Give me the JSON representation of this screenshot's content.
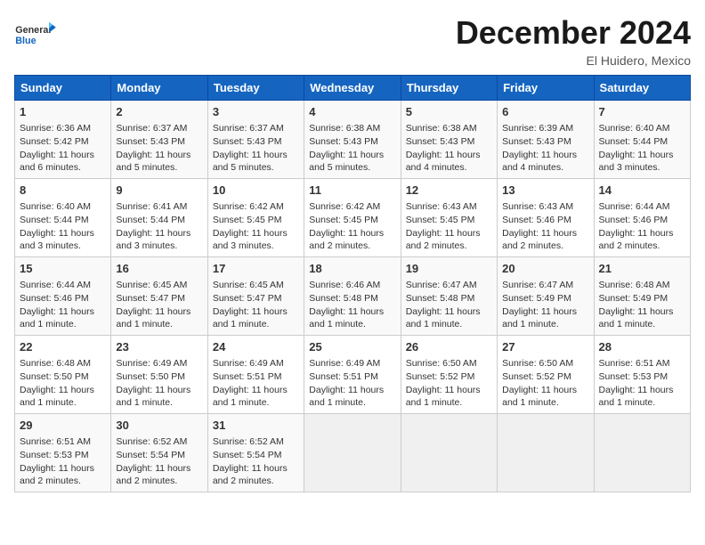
{
  "header": {
    "logo_general": "General",
    "logo_blue": "Blue",
    "month_title": "December 2024",
    "location": "El Huidero, Mexico"
  },
  "days_of_week": [
    "Sunday",
    "Monday",
    "Tuesday",
    "Wednesday",
    "Thursday",
    "Friday",
    "Saturday"
  ],
  "weeks": [
    [
      {
        "day": "1",
        "sunrise": "Sunrise: 6:36 AM",
        "sunset": "Sunset: 5:42 PM",
        "daylight": "Daylight: 11 hours and 6 minutes."
      },
      {
        "day": "2",
        "sunrise": "Sunrise: 6:37 AM",
        "sunset": "Sunset: 5:43 PM",
        "daylight": "Daylight: 11 hours and 5 minutes."
      },
      {
        "day": "3",
        "sunrise": "Sunrise: 6:37 AM",
        "sunset": "Sunset: 5:43 PM",
        "daylight": "Daylight: 11 hours and 5 minutes."
      },
      {
        "day": "4",
        "sunrise": "Sunrise: 6:38 AM",
        "sunset": "Sunset: 5:43 PM",
        "daylight": "Daylight: 11 hours and 5 minutes."
      },
      {
        "day": "5",
        "sunrise": "Sunrise: 6:38 AM",
        "sunset": "Sunset: 5:43 PM",
        "daylight": "Daylight: 11 hours and 4 minutes."
      },
      {
        "day": "6",
        "sunrise": "Sunrise: 6:39 AM",
        "sunset": "Sunset: 5:43 PM",
        "daylight": "Daylight: 11 hours and 4 minutes."
      },
      {
        "day": "7",
        "sunrise": "Sunrise: 6:40 AM",
        "sunset": "Sunset: 5:44 PM",
        "daylight": "Daylight: 11 hours and 3 minutes."
      }
    ],
    [
      {
        "day": "8",
        "sunrise": "Sunrise: 6:40 AM",
        "sunset": "Sunset: 5:44 PM",
        "daylight": "Daylight: 11 hours and 3 minutes."
      },
      {
        "day": "9",
        "sunrise": "Sunrise: 6:41 AM",
        "sunset": "Sunset: 5:44 PM",
        "daylight": "Daylight: 11 hours and 3 minutes."
      },
      {
        "day": "10",
        "sunrise": "Sunrise: 6:42 AM",
        "sunset": "Sunset: 5:45 PM",
        "daylight": "Daylight: 11 hours and 3 minutes."
      },
      {
        "day": "11",
        "sunrise": "Sunrise: 6:42 AM",
        "sunset": "Sunset: 5:45 PM",
        "daylight": "Daylight: 11 hours and 2 minutes."
      },
      {
        "day": "12",
        "sunrise": "Sunrise: 6:43 AM",
        "sunset": "Sunset: 5:45 PM",
        "daylight": "Daylight: 11 hours and 2 minutes."
      },
      {
        "day": "13",
        "sunrise": "Sunrise: 6:43 AM",
        "sunset": "Sunset: 5:46 PM",
        "daylight": "Daylight: 11 hours and 2 minutes."
      },
      {
        "day": "14",
        "sunrise": "Sunrise: 6:44 AM",
        "sunset": "Sunset: 5:46 PM",
        "daylight": "Daylight: 11 hours and 2 minutes."
      }
    ],
    [
      {
        "day": "15",
        "sunrise": "Sunrise: 6:44 AM",
        "sunset": "Sunset: 5:46 PM",
        "daylight": "Daylight: 11 hours and 1 minute."
      },
      {
        "day": "16",
        "sunrise": "Sunrise: 6:45 AM",
        "sunset": "Sunset: 5:47 PM",
        "daylight": "Daylight: 11 hours and 1 minute."
      },
      {
        "day": "17",
        "sunrise": "Sunrise: 6:45 AM",
        "sunset": "Sunset: 5:47 PM",
        "daylight": "Daylight: 11 hours and 1 minute."
      },
      {
        "day": "18",
        "sunrise": "Sunrise: 6:46 AM",
        "sunset": "Sunset: 5:48 PM",
        "daylight": "Daylight: 11 hours and 1 minute."
      },
      {
        "day": "19",
        "sunrise": "Sunrise: 6:47 AM",
        "sunset": "Sunset: 5:48 PM",
        "daylight": "Daylight: 11 hours and 1 minute."
      },
      {
        "day": "20",
        "sunrise": "Sunrise: 6:47 AM",
        "sunset": "Sunset: 5:49 PM",
        "daylight": "Daylight: 11 hours and 1 minute."
      },
      {
        "day": "21",
        "sunrise": "Sunrise: 6:48 AM",
        "sunset": "Sunset: 5:49 PM",
        "daylight": "Daylight: 11 hours and 1 minute."
      }
    ],
    [
      {
        "day": "22",
        "sunrise": "Sunrise: 6:48 AM",
        "sunset": "Sunset: 5:50 PM",
        "daylight": "Daylight: 11 hours and 1 minute."
      },
      {
        "day": "23",
        "sunrise": "Sunrise: 6:49 AM",
        "sunset": "Sunset: 5:50 PM",
        "daylight": "Daylight: 11 hours and 1 minute."
      },
      {
        "day": "24",
        "sunrise": "Sunrise: 6:49 AM",
        "sunset": "Sunset: 5:51 PM",
        "daylight": "Daylight: 11 hours and 1 minute."
      },
      {
        "day": "25",
        "sunrise": "Sunrise: 6:49 AM",
        "sunset": "Sunset: 5:51 PM",
        "daylight": "Daylight: 11 hours and 1 minute."
      },
      {
        "day": "26",
        "sunrise": "Sunrise: 6:50 AM",
        "sunset": "Sunset: 5:52 PM",
        "daylight": "Daylight: 11 hours and 1 minute."
      },
      {
        "day": "27",
        "sunrise": "Sunrise: 6:50 AM",
        "sunset": "Sunset: 5:52 PM",
        "daylight": "Daylight: 11 hours and 1 minute."
      },
      {
        "day": "28",
        "sunrise": "Sunrise: 6:51 AM",
        "sunset": "Sunset: 5:53 PM",
        "daylight": "Daylight: 11 hours and 1 minute."
      }
    ],
    [
      {
        "day": "29",
        "sunrise": "Sunrise: 6:51 AM",
        "sunset": "Sunset: 5:53 PM",
        "daylight": "Daylight: 11 hours and 2 minutes."
      },
      {
        "day": "30",
        "sunrise": "Sunrise: 6:52 AM",
        "sunset": "Sunset: 5:54 PM",
        "daylight": "Daylight: 11 hours and 2 minutes."
      },
      {
        "day": "31",
        "sunrise": "Sunrise: 6:52 AM",
        "sunset": "Sunset: 5:54 PM",
        "daylight": "Daylight: 11 hours and 2 minutes."
      },
      null,
      null,
      null,
      null
    ]
  ]
}
